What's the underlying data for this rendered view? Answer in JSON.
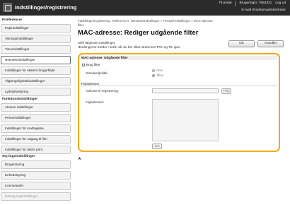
{
  "header": {
    "title": "Indstillinger/registrering",
    "top_links": [
      "Til portal",
      "Brugerlogin: 7654321",
      "Log ud"
    ],
    "email_link": "E-mail til systemadministrator"
  },
  "sidebar": {
    "sections": [
      {
        "title": "Præferencer",
        "items": [
          {
            "label": "Papirindstillinger",
            "active": false,
            "dim": false
          },
          {
            "label": "Visningsindstillinger",
            "active": false,
            "dim": false
          },
          {
            "label": "Timerindstillinger",
            "active": false,
            "dim": false
          },
          {
            "label": "Netværksindstillinger",
            "active": true,
            "dim": false
          },
          {
            "label": "Indstillinger for ekstern brugerflade",
            "active": false,
            "dim": false
          },
          {
            "label": "Tilgængelighedsindstillinger",
            "active": false,
            "dim": false
          },
          {
            "label": "Lydstyrkestyring",
            "active": false,
            "dim": false
          }
        ]
      },
      {
        "title": "Funktionsindstillinger",
        "items": [
          {
            "label": "Almene indstillinger",
            "active": false,
            "dim": false
          },
          {
            "label": "Printerindstillinger",
            "active": false,
            "dim": false
          },
          {
            "label": "Indstillinger for modtagelse",
            "active": false,
            "dim": false
          },
          {
            "label": "Indstillinger for Adgang til filer",
            "active": false,
            "dim": false
          },
          {
            "label": "Indstillinger for Sikret print",
            "active": false,
            "dim": false
          }
        ]
      },
      {
        "title": "Styringsindstillinger",
        "items": [
          {
            "label": "Brugerstyring",
            "active": false,
            "dim": false
          },
          {
            "label": "Enhedsstyring",
            "active": false,
            "dim": false
          },
          {
            "label": "Licens/andet",
            "active": false,
            "dim": false
          },
          {
            "label": "Datastyringindstillinger",
            "active": false,
            "dim": true
          }
        ]
      }
    ]
  },
  "main": {
    "breadcrumb_line1": "Indstillinger/registrering: Præferencer: Netværksindstillinger > Firewall-indstillinger > MAC-adresse-",
    "breadcrumb_line2": "filter",
    "title": "MAC-adresse: Rediger udgående filter",
    "info_line1": "Skift følgende indstillinger.",
    "info_line2": "Ændringerne træder i kraft, når du har slået strømmen FRA og TIL igen.",
    "ok_label": "OK",
    "cancel_label": "Annuller",
    "panel": {
      "heading": "MAC-adresse: Udgående filter",
      "use_filter_label": "Brug filter",
      "use_filter_checked": false,
      "policy_label": "Standardpolitik:",
      "policy_options": [
        {
          "label": "Afvis",
          "selected": false
        },
        {
          "label": "Tillad",
          "selected": true
        }
      ],
      "exceptions_heading": "Fejladresser",
      "address_label": "Adresse til registrering:",
      "address_value": "",
      "add_label": "Tilføj",
      "exceptions_list_label": "Fejladresser:",
      "delete_label": "Slet"
    }
  },
  "footer": {
    "icon": "up-arrow-icon",
    "glyph": "⮝"
  },
  "colors": {
    "topbar": "#2b2b2b",
    "highlight": "#f3a91a"
  }
}
